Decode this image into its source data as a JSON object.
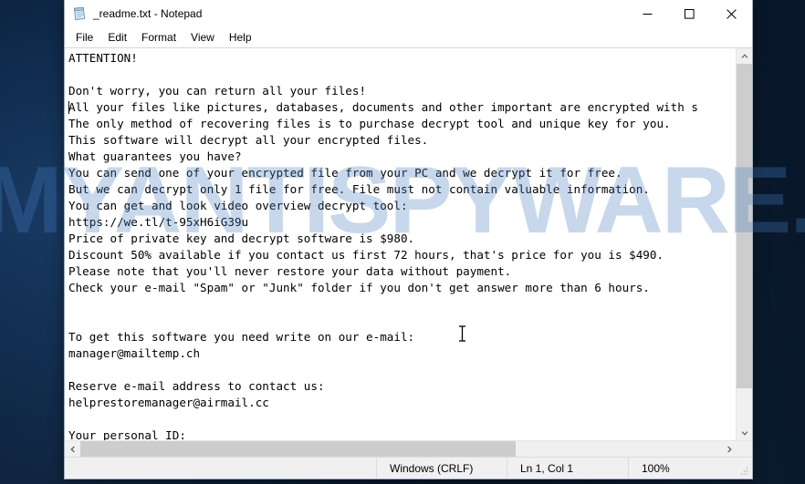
{
  "window": {
    "title": "_readme.txt - Notepad",
    "icon": "notepad-icon",
    "controls": {
      "minimize": "minimize-icon",
      "maximize": "maximize-icon",
      "close": "close-icon"
    }
  },
  "menu": {
    "items": [
      {
        "label": "File"
      },
      {
        "label": "Edit"
      },
      {
        "label": "Format"
      },
      {
        "label": "View"
      },
      {
        "label": "Help"
      }
    ]
  },
  "document": {
    "filename": "_readme.txt",
    "body": "ATTENTION!\n\nDon't worry, you can return all your files!\nAll your files like pictures, databases, documents and other important are encrypted with s\nThe only method of recovering files is to purchase decrypt tool and unique key for you.\nThis software will decrypt all your encrypted files.\nWhat guarantees you have?\nYou can send one of your encrypted file from your PC and we decrypt it for free.\nBut we can decrypt only 1 file for free. File must not contain valuable information.\nYou can get and look video overview decrypt tool:\nhttps://we.tl/t-95xH6iG39u\nPrice of private key and decrypt software is $980.\nDiscount 50% available if you contact us first 72 hours, that's price for you is $490.\nPlease note that you'll never restore your data without payment.\nCheck your e-mail \"Spam\" or \"Junk\" folder if you don't get answer more than 6 hours.\n\n\nTo get this software you need write on our e-mail:\nmanager@mailtemp.ch\n\nReserve e-mail address to contact us:\nhelprestoremanager@airmail.cc\n\nYour personal ID:",
    "video_url": "https://we.tl/t-95xH6iG39u",
    "price_full": "$980",
    "price_discount": "$490",
    "discount_percent": "50%",
    "discount_window_hours": "72 hours",
    "response_time_hours": "6 hours",
    "primary_email": "manager@mailtemp.ch",
    "reserve_email": "helprestoremanager@airmail.cc"
  },
  "scrollbars": {
    "vertical": {
      "up_arrow": "chevron-up-icon",
      "down_arrow": "chevron-down-icon",
      "thumb_fraction": 0.9
    },
    "horizontal": {
      "left_arrow": "chevron-left-icon",
      "right_arrow": "chevron-right-icon",
      "thumb_fraction": 0.68
    }
  },
  "status_bar": {
    "encoding": "Windows (CRLF)",
    "position": "Ln 1, Col 1",
    "zoom": "100%"
  },
  "watermark": {
    "text": "MYANTISPYWARE.COM",
    "color": "#467ec4"
  },
  "cursor": {
    "type": "i-beam-cursor"
  }
}
